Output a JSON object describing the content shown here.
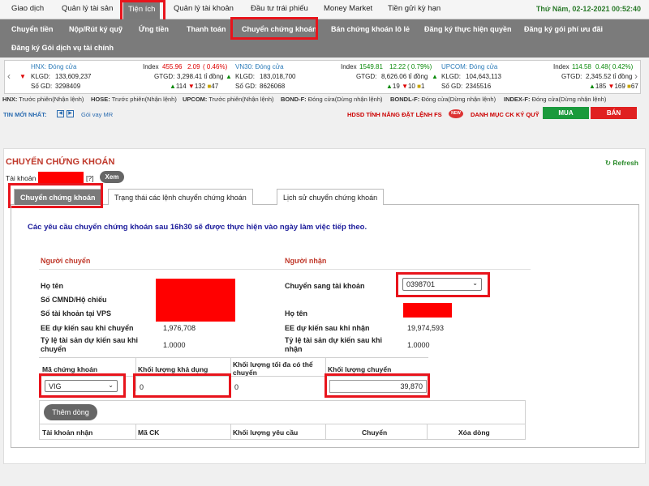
{
  "topnav": {
    "items": [
      "Giao dịch",
      "Quản lý tài sản",
      "Tiện ích",
      "Quản lý tài khoản",
      "Đầu tư trái phiếu",
      "Money Market",
      "Tiền gửi kỳ hạn"
    ],
    "datetime": "Thứ Năm, 02-12-2021 00:52:40"
  },
  "subnav": {
    "row1": [
      "Chuyển tiền",
      "Nộp/Rút ký quỹ",
      "Ứng tiền",
      "Thanh toán",
      "Chuyển chứng khoán",
      "Bán chứng khoán lô lẻ",
      "Đăng ký thực hiện quyền",
      "Đăng ký gói phí ưu đãi"
    ],
    "row2": [
      "Đăng ký Gói dịch vụ tài chính"
    ]
  },
  "ticker": {
    "hnx": {
      "name": "HNX: Đóng cửa",
      "index_label": "Index",
      "index": "455.96",
      "change": "2.09",
      "pct": "( 0.46%)",
      "klgd_label": "KLGD:",
      "klgd": "133,609,237",
      "gtgd_label": "GTGD:",
      "gtgd": "3,298.41 tỉ đồng",
      "sogd_label": "Số GD:",
      "sogd": "3298409",
      "up": "114",
      "down": "132",
      "eq": "47"
    },
    "vn30": {
      "name": "VN30: Đóng cửa",
      "index_label": "Index",
      "index": "1549.81",
      "change": "12.22",
      "pct": "( 0.79%)",
      "klgd_label": "KLGD:",
      "klgd": "183,018,700",
      "gtgd_label": "GTGD:",
      "gtgd": "8,626.06 tỉ đồng",
      "sogd_label": "Số GD:",
      "sogd": "8626068",
      "up": "19",
      "down": "10",
      "eq": "1"
    },
    "upcom": {
      "name": "UPCOM: Đóng cửa",
      "index_label": "Index",
      "index": "114.58",
      "change": "0.48",
      "pct": "( 0.42%)",
      "klgd_label": "KLGD:",
      "klgd": "104,643,113",
      "gtgd_label": "GTGD:",
      "gtgd": "2,345.52 tỉ đồng",
      "sogd_label": "Số GD:",
      "sogd": "2345516",
      "up": "185",
      "down": "169",
      "eq": "67"
    }
  },
  "statusbar": {
    "hnx": "HNX:",
    "hnx_v": "Trước phiên(Nhận lệnh)",
    "hose": "HOSE:",
    "hose_v": "Trước phiên(Nhận lệnh)",
    "upcom": "UPCOM:",
    "upcom_v": "Trước phiên(Nhận lệnh)",
    "bondf": "BOND-F:",
    "bondf_v": "Đóng cửa(Dừng nhận lệnh)",
    "bondlf": "BONDL-F:",
    "bondlf_v": "Đóng cửa(Dừng nhận lệnh)",
    "indexf": "INDEX-F:",
    "indexf_v": "Đóng cửa(Dừng nhận lệnh)"
  },
  "newsrow": {
    "label": "TIN MỚI NHẤT:",
    "news": "Gói vay MR",
    "guide": "HDSD TÍNH NĂNG ĐẶT LỆNH FS",
    "new_badge": "NEW",
    "watchlist": "DANH MỤC CK KÝ QUỸ",
    "buy": "MUA",
    "sell": "BÁN"
  },
  "panel": {
    "title": "CHUYỂN CHỨNG KHOÁN",
    "refresh": "Refresh",
    "account_label": "Tài khoản",
    "help": "[?]",
    "view": "Xem",
    "tabs": [
      "Chuyển chứng khoán",
      "Trạng thái các lệnh chuyển chứng khoán",
      "Lịch sử chuyển chứng khoán"
    ],
    "notice": "Các yêu cầu chuyển chứng khoán sau 16h30 sẽ được thực hiện vào ngày làm việc tiếp theo.",
    "sender": {
      "header": "Người chuyển",
      "name_label": "Họ tên",
      "id_label": "Số CMND/Hộ chiếu",
      "account_label": "Số tài khoản tại VPS",
      "ee_label": "EE dự kiến sau khi chuyển",
      "ee_value": "1,976,708",
      "ratio_label": "Tỷ lệ tài sản dự kiến sau khi chuyển",
      "ratio_value": "1.0000"
    },
    "receiver": {
      "header": "Người nhận",
      "to_account_label": "Chuyển sang tài khoản",
      "to_account_value": "0398701",
      "name_label": "Họ tên",
      "ee_label": "EE dự kiến sau khi nhận",
      "ee_value": "19,974,593",
      "ratio_label": "Tỷ lệ tài sản dự kiến sau khi nhận",
      "ratio_value": "1.0000"
    },
    "table": {
      "headers": [
        "Mã chứng khoán",
        "Khối lượng khả dụng",
        "Khối lượng tối đa có thể chuyển",
        "Khối lượng chuyển"
      ],
      "row": {
        "symbol": "VIG",
        "available": "0",
        "max": "0",
        "amount": "39,870"
      },
      "add_button": "Thêm dòng",
      "bottom_headers": [
        "Tài khoản nhận",
        "Mã CK",
        "Khối lượng yêu cầu",
        "Chuyển",
        "Xóa dòng"
      ]
    }
  }
}
